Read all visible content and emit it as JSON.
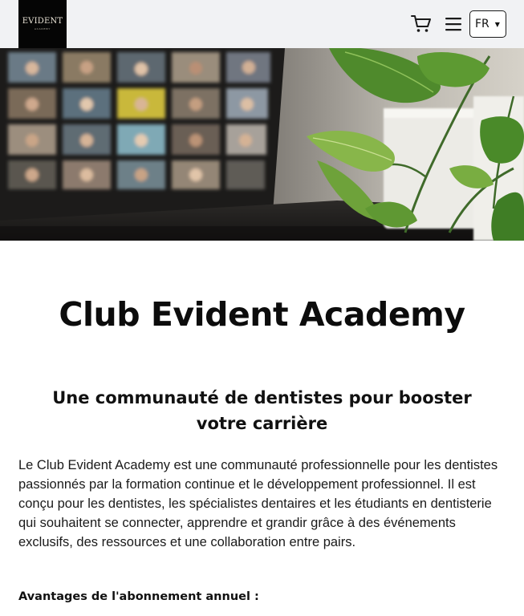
{
  "header": {
    "logo_text": "EVIDENT",
    "logo_subtext": "ACADEMY",
    "cart_icon": "shopping-cart-icon",
    "menu_icon": "hamburger-menu-icon",
    "language_selected": "FR",
    "caret": "▼"
  },
  "hero": {
    "image": "photo-video-conference-laptop-with-plant"
  },
  "main": {
    "title": "Club Evident Academy",
    "subtitle": "Une communauté de dentistes pour booster votre carrière",
    "description": "Le Club Evident Academy est une communauté professionnelle pour les dentistes passionnés par la formation continue et le développement professionnel. Il est conçu pour les dentistes, les spécialistes dentaires et les étudiants en dentisterie qui souhaitent se connecter, apprendre et grandir grâce à des événements exclusifs, des ressources et une collaboration entre pairs.",
    "benefits_heading": "Avantages de l'abonnement annuel :"
  },
  "colors": {
    "header_bg": "#f1f2f4",
    "logo_bg": "#050505",
    "text": "#111111"
  }
}
